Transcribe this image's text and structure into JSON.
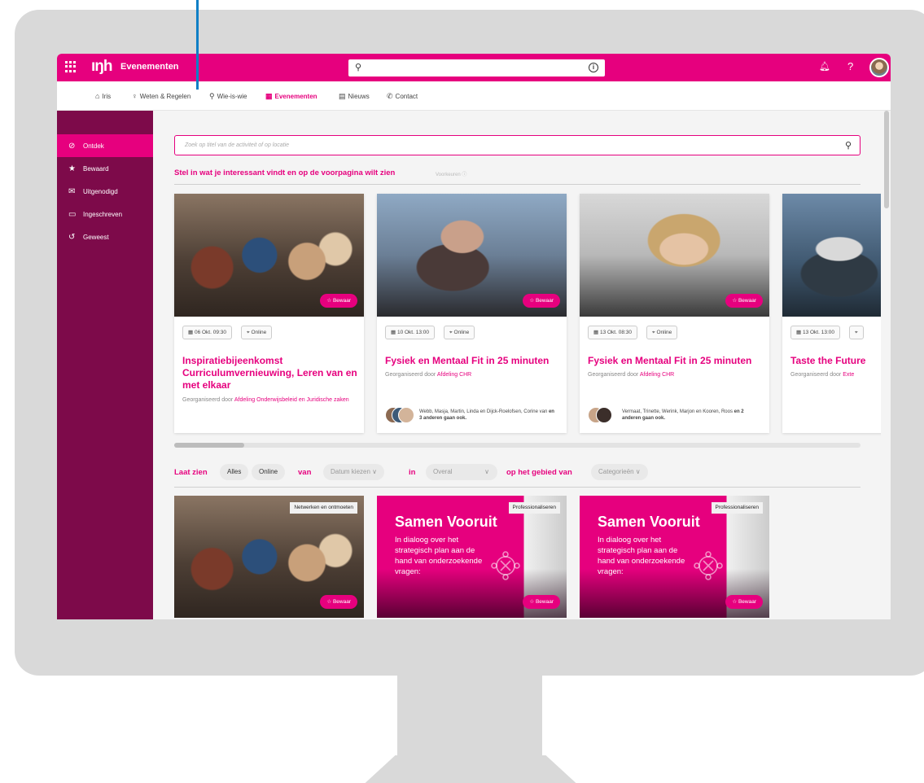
{
  "topbar": {
    "logo": "ıŋh",
    "app_name": "Evenementen"
  },
  "nav": [
    {
      "icon": "⌂",
      "label": "Iris"
    },
    {
      "icon": "♀",
      "label": "Weten & Regelen"
    },
    {
      "icon": "⚲",
      "label": "Wie-is-wie"
    },
    {
      "icon": "▦",
      "label": "Evenementen"
    },
    {
      "icon": "▤",
      "label": "Nieuws"
    },
    {
      "icon": "✆",
      "label": "Contact"
    }
  ],
  "sidebar": [
    {
      "icon": "⊘",
      "label": "Ontdek"
    },
    {
      "icon": "★",
      "label": "Bewaard"
    },
    {
      "icon": "✉",
      "label": "Uitgenodigd"
    },
    {
      "icon": "▭",
      "label": "Ingeschreven"
    },
    {
      "icon": "↺",
      "label": "Geweest"
    }
  ],
  "search": {
    "placeholder": "Zoek op titel van de activiteit of op locatie"
  },
  "preferences": {
    "title": "Stel in wat je interessant vindt en op de voorpagina wilt zien",
    "link": "Voorkeuren ⓘ"
  },
  "cards": [
    {
      "date": "06 Okt. 09:30",
      "location": "Online",
      "title": "Inspiratiebijeenkomst Curriculumvernieuwing, Leren van en met elkaar",
      "organized_by": "Georganiseerd door",
      "organizer": "Afdeling Onderwijsbeleid en Juridische zaken",
      "attendees": "",
      "attendees_bold": "",
      "save_label": "☆ Bewaar"
    },
    {
      "date": "10 Okt. 13:00",
      "location": "Online",
      "title": "Fysiek en Mentaal Fit in 25 minuten",
      "organized_by": "Georganiseerd door",
      "organizer": "Afdeling CHR",
      "attendees": "Webb, Masja, Martin, Linda en Dijck-Roelofsen, Corine van",
      "attendees_bold": "en 3 anderen gaan ook.",
      "save_label": "☆ Bewaar"
    },
    {
      "date": "13 Okt. 08:30",
      "location": "Online",
      "title": "Fysiek en Mentaal Fit in 25 minuten",
      "organized_by": "Georganiseerd door",
      "organizer": "Afdeling CHR",
      "attendees": "Vermaat, Trinette, Werink, Marjon en Kooren, Roos",
      "attendees_bold": "en 2 anderen gaan ook.",
      "save_label": "☆ Bewaar"
    },
    {
      "date": "13 Okt. 13:00",
      "location": "",
      "title": "Taste the Future",
      "organized_by": "Georganiseerd door",
      "organizer": "Exte",
      "attendees": "",
      "attendees_bold": "",
      "save_label": ""
    }
  ],
  "filter": {
    "show_label": "Laat zien",
    "all": "Alles",
    "online": "Online",
    "from_label": "van",
    "date": "Datum kiezen ∨",
    "in_label": "in",
    "place": "Overal",
    "place_arrow": "∨",
    "area_label": "op het gebied van",
    "category": "Categorieën ∨"
  },
  "events": [
    {
      "tag": "Netwerken en ontmoeten",
      "save_label": "☆ Bewaar"
    },
    {
      "tag": "Professionaliseren",
      "title": "Samen Vooruit",
      "subtitle": "In dialoog over het strategisch plan aan de hand van onderzoekende vragen:",
      "save_label": "☆ Bewaar"
    },
    {
      "tag": "Professionaliseren",
      "title": "Samen Vooruit",
      "subtitle": "In dialoog over het strategisch plan aan de hand van onderzoekende vragen:",
      "save_label": "☆ Bewaar"
    }
  ],
  "colors": {
    "brand": "#e6007e",
    "sidebar": "#7d0a4a"
  }
}
